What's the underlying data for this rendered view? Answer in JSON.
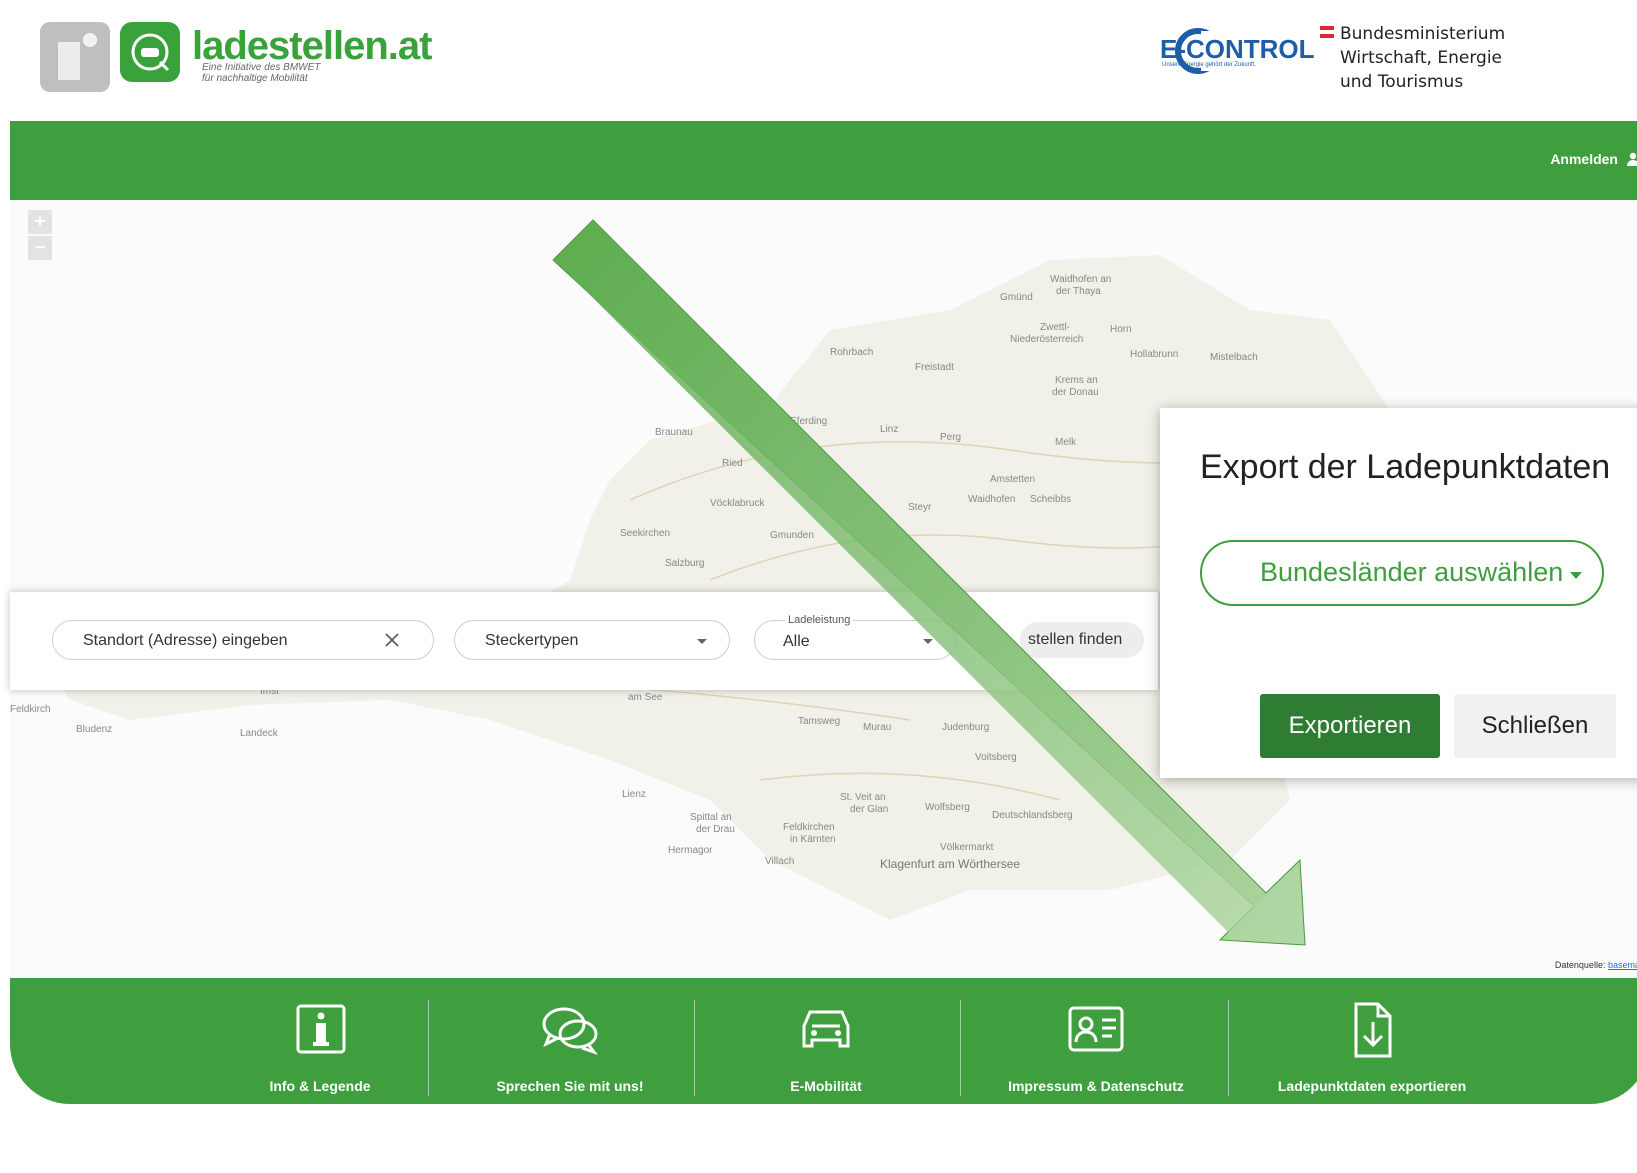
{
  "header": {
    "brand_name": "ladestellen.at",
    "brand_tagline_1": "Eine Initiative des BMWET",
    "brand_tagline_2": "für nachhaltige Mobilität",
    "partner_logo": "E-CONTROL",
    "partner_logo_sub": "Unsere Energie gehört der Zukunft.",
    "ministry_line_1": "Bundesministerium",
    "ministry_line_2": "Wirtschaft, Energie",
    "ministry_line_3": "und Tourismus"
  },
  "nav": {
    "login_label": "Anmelden",
    "login_icon": "user-icon"
  },
  "map": {
    "zoom_in": "+",
    "zoom_out": "−",
    "source_label": "Datenquelle:",
    "source_link": "basema"
  },
  "search": {
    "location_placeholder": "Standort (Adresse) eingeben",
    "clear_icon": "close-icon",
    "plug_types": "Steckertypen",
    "power_label": "Ladeleistung",
    "power_value": "Alle",
    "find_button": "stellen finden"
  },
  "dialog": {
    "title": "Export der Ladepunktdaten",
    "select_placeholder": "Bundesländer auswählen",
    "export_button": "Exportieren",
    "close_button": "Schließen"
  },
  "footer": {
    "items": [
      {
        "label": "Info & Legende",
        "icon": "info-icon"
      },
      {
        "label": "Sprechen Sie mit uns!",
        "icon": "chat-icon"
      },
      {
        "label": "E-Mobilität",
        "icon": "car-icon"
      },
      {
        "label": "Impressum & Datenschutz",
        "icon": "id-card-icon"
      },
      {
        "label": "Ladepunktdaten exportieren",
        "icon": "download-file-icon"
      }
    ]
  },
  "colors": {
    "brand_green": "#3f9f3f",
    "export_green": "#2e7d32",
    "econtrol_blue": "#1d5ea8"
  }
}
